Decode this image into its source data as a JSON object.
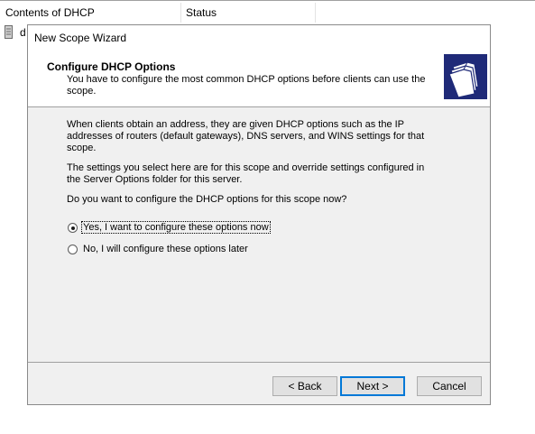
{
  "background": {
    "columns": [
      "Contents of DHCP",
      "Status"
    ],
    "row_text": "d"
  },
  "wizard": {
    "title": "New Scope Wizard",
    "header": {
      "title": "Configure DHCP Options",
      "subtitle": "You have to configure the most common DHCP options before clients can use the scope."
    },
    "body": {
      "paragraph1": "When clients obtain an address, they are given DHCP options such as the IP addresses of routers (default gateways), DNS servers, and WINS settings for that scope.",
      "paragraph2": "The settings you select here are for this scope and override settings configured in the Server Options folder for this server.",
      "question": "Do you want to configure the DHCP options for this scope now?"
    },
    "options": [
      {
        "label": "Yes, I want to configure these options now",
        "selected": true
      },
      {
        "label": "No, I will configure these options later",
        "selected": false
      }
    ],
    "buttons": {
      "back": "< Back",
      "next": "Next >",
      "cancel": "Cancel"
    }
  }
}
